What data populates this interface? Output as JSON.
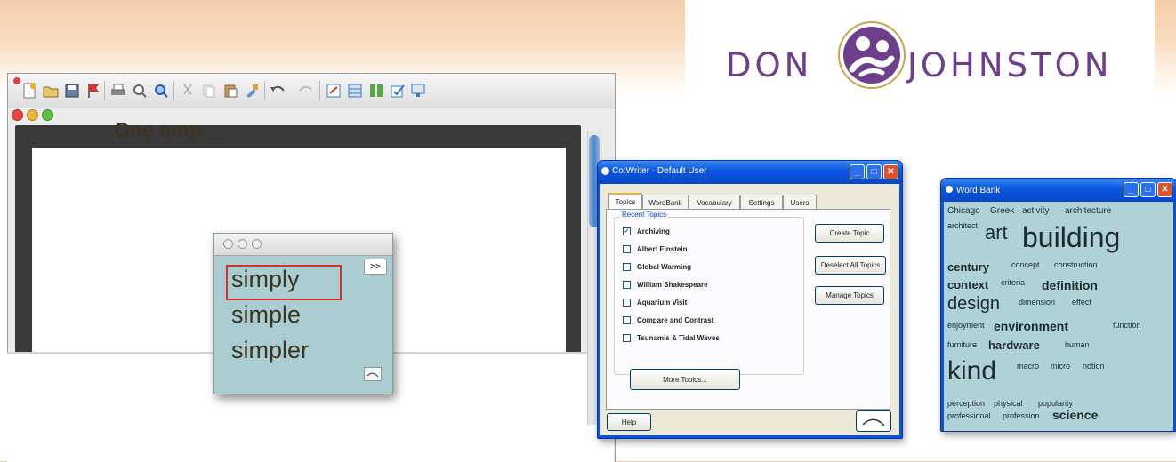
{
  "logo": {
    "word_left": "DON",
    "word_right": "JOHNSTON",
    "brand_color": "#6d3f8b",
    "accent_color": "#c9a64a"
  },
  "editor": {
    "document_text": "One smp__",
    "toolbar_icons": [
      "new-document-icon",
      "open-folder-icon",
      "save-icon",
      "flag-icon",
      "print-icon",
      "print-preview-icon",
      "zoom-icon",
      "cut-icon",
      "copy-icon",
      "paste-icon",
      "format-painter-icon",
      "undo-icon",
      "redo-icon",
      "insert-icon",
      "table-icon",
      "columns-icon",
      "checklist-icon",
      "drawing-icon"
    ]
  },
  "prediction": {
    "more_label": ">>",
    "words": [
      "simply",
      "simple",
      "simpler"
    ],
    "selected_index": 0,
    "highlight_color": "#d8322e"
  },
  "cowriter": {
    "title": "Co:Writer - Default User",
    "tabs": [
      "Topics",
      "WordBank",
      "Vocabulary",
      "Settings",
      "Users"
    ],
    "active_tab": "Topics",
    "group_label": "Recent Topics",
    "topics": [
      {
        "label": "Archiving",
        "checked": true
      },
      {
        "label": "Albert Einstein",
        "checked": false
      },
      {
        "label": "Global Warming",
        "checked": false
      },
      {
        "label": "William Shakespeare",
        "checked": false
      },
      {
        "label": "Aquarium Visit",
        "checked": false
      },
      {
        "label": "Compare and Contrast",
        "checked": false
      },
      {
        "label": "Tsunamis & Tidal Waves",
        "checked": false
      }
    ],
    "buttons": {
      "create": "Create Topic",
      "deselect": "Deselect All Topics",
      "manage": "Manage Topics",
      "more": "More Topics...",
      "help": "Help"
    }
  },
  "wordbank": {
    "title": "Word Bank",
    "words": [
      "Chicago",
      "Greek",
      "activity",
      "architecture",
      "architect",
      "art",
      "building",
      "century",
      "concept",
      "construction",
      "context",
      "criteria",
      "definition",
      "design",
      "dimension",
      "effect",
      "enjoyment",
      "environment",
      "function",
      "furniture",
      "hardware",
      "human",
      "kind",
      "macro",
      "micro",
      "notion",
      "perception",
      "physical",
      "popularity",
      "professional",
      "profession",
      "science"
    ]
  }
}
